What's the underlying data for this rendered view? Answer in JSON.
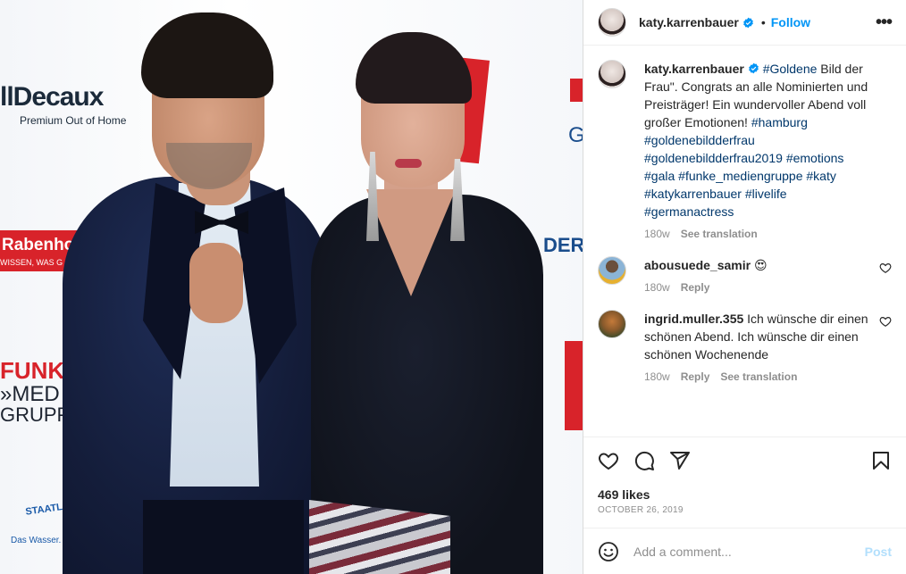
{
  "post": {
    "author": "katy.karrenbauer",
    "follow_label": "Follow",
    "separator": "•",
    "more_label": "•••"
  },
  "caption": {
    "username": "katy.karrenbauer",
    "text_start": "#Goldene",
    "text_body": " Bild der Frau\". Congrats an alle Nominierten und Preisträger! Ein wundervoller Abend voll großer Emotionen!",
    "hashtags": [
      "#hamburg",
      "#goldenebildderfrau",
      "#goldenebildderfrau2019",
      "#emotions",
      "#gala",
      "#funke_mediengruppe",
      "#katy",
      "#katykarrenbauer",
      "#livelife",
      "#germanactress"
    ],
    "age": "180w",
    "see_translation": "See translation"
  },
  "comments": [
    {
      "username": "abousuede_samir",
      "text": "😍",
      "age": "180w",
      "reply": "Reply"
    },
    {
      "username": "ingrid.muller.355",
      "text": "Ich wünsche dir einen schönen Abend. Ich wünsche dir einen schönen Wochenende",
      "age": "180w",
      "reply": "Reply",
      "see_translation": "See translation"
    }
  ],
  "engagement": {
    "likes": "469 likes",
    "date": "OCTOBER 26, 2019"
  },
  "composer": {
    "placeholder": "Add a comment...",
    "post_label": "Post"
  },
  "photo_backdrop": {
    "jcdecaux": "llDecaux",
    "jcdecaux_sub": "Premium Out of Home",
    "rabenhorst": "Rabenhor",
    "rabenhorst_sub": "WISSEN, WAS G",
    "funke": "FUNK",
    "medien": "»MED",
    "gruppe": "GRUPPE",
    "staatl": "STAATL. FACHINGEN",
    "staatl_sub": "Das Wasser. Seit",
    "der": "DER",
    "g_letter": "G"
  },
  "colors": {
    "accent": "#0095f6",
    "hashtag": "#00376b",
    "muted": "#8e8e8e",
    "post_disabled": "#b2dffc"
  }
}
